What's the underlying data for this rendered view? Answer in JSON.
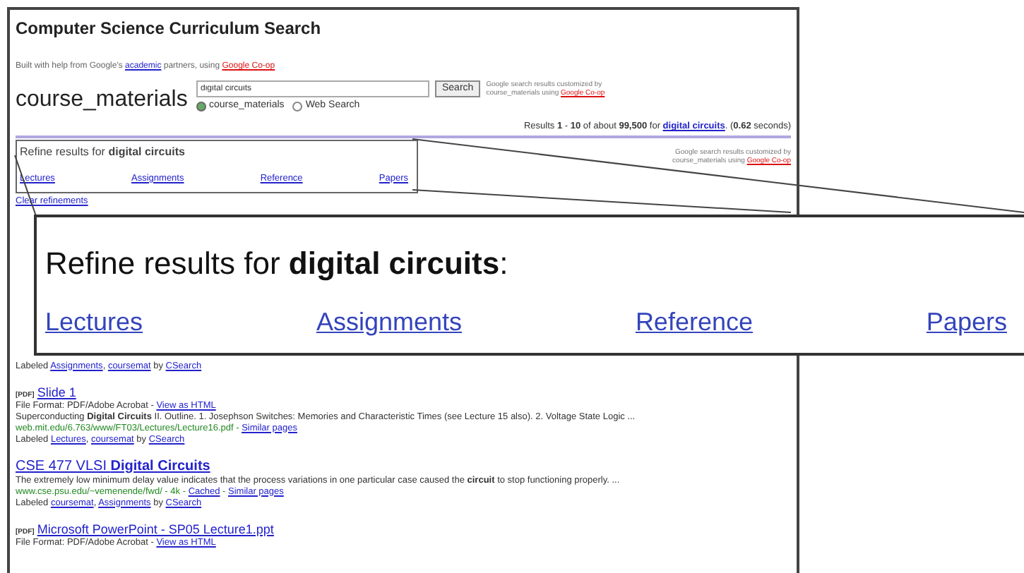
{
  "header": {
    "title": "Computer Science Curriculum Search",
    "credit": [
      {
        "kind": "plain",
        "text": "Built with help from Google's "
      },
      {
        "kind": "link",
        "text": "academic"
      },
      {
        "kind": "plain",
        "text": " partners, using "
      },
      {
        "kind": "red",
        "text": "Google Co-op"
      }
    ]
  },
  "search": {
    "engine_name": "course_materials",
    "query": "digital circuits",
    "button": "Search",
    "options": [
      {
        "label": "course_materials",
        "selected": true
      },
      {
        "label": "Web Search",
        "selected": false
      }
    ],
    "note": [
      {
        "kind": "plain",
        "text": "Google search results customized by course_materials using "
      },
      {
        "kind": "red",
        "text": "Google Co-op"
      }
    ]
  },
  "results_summary": [
    {
      "kind": "plain",
      "text": "Results "
    },
    {
      "kind": "bold",
      "text": "1"
    },
    {
      "kind": "plain",
      "text": " - "
    },
    {
      "kind": "bold",
      "text": "10"
    },
    {
      "kind": "plain",
      "text": " of about "
    },
    {
      "kind": "bold",
      "text": "99,500"
    },
    {
      "kind": "plain",
      "text": " for "
    },
    {
      "kind": "boldlink",
      "text": "digital circuits"
    },
    {
      "kind": "plain",
      "text": ". ("
    },
    {
      "kind": "bold",
      "text": "0.62"
    },
    {
      "kind": "plain",
      "text": " seconds)"
    }
  ],
  "refine": {
    "heading": "Refine results for **digital circuits**",
    "links": [
      "Lectures",
      "Assignments",
      "Reference",
      "Papers"
    ],
    "clear": "Clear refinements"
  },
  "side_note": [
    {
      "kind": "plain",
      "text": "Google search results customized by course_materials using "
    },
    {
      "kind": "red",
      "text": "Google Co-op"
    }
  ],
  "callout": {
    "heading": "Refine results for **digital circuits**:",
    "links": [
      "Lectures",
      "Assignments",
      "Reference",
      "Papers"
    ]
  },
  "results": [
    {
      "labels": [
        {
          "kind": "plain",
          "text": "Labeled "
        },
        {
          "kind": "link",
          "text": "Assignments"
        },
        {
          "kind": "plain",
          "text": ", "
        },
        {
          "kind": "link",
          "text": "coursemat"
        },
        {
          "kind": "plain",
          "text": " by "
        },
        {
          "kind": "link",
          "text": "CSearch"
        }
      ]
    },
    {
      "file_type": "[PDF]",
      "title": "Slide 1",
      "format": [
        {
          "kind": "plain",
          "text": "File Format: PDF/Adobe Acrobat - "
        },
        {
          "kind": "link",
          "text": "View as HTML"
        }
      ],
      "snippet": "Superconducting **Digital Circuits** II. Outline. 1. Josephson Switches: Memories and Characteristic Times (see Lecture 15 also). 2. Voltage State Logic ...",
      "url": [
        {
          "kind": "url",
          "text": "web.mit.edu/6.763/www/FT03/Lectures/Lecture16.pdf - "
        },
        {
          "kind": "link",
          "text": "Similar pages"
        }
      ],
      "labels": [
        {
          "kind": "plain",
          "text": "Labeled "
        },
        {
          "kind": "link",
          "text": "Lectures"
        },
        {
          "kind": "plain",
          "text": ", "
        },
        {
          "kind": "link",
          "text": "coursemat"
        },
        {
          "kind": "plain",
          "text": " by "
        },
        {
          "kind": "link",
          "text": "CSearch"
        }
      ]
    },
    {
      "title": "CSE 477 VLSI **Digital Circuits**",
      "snippet": "The extremely low minimum delay value indicates that the process variations in one particular case caused the **circuit** to stop functioning properly. ...",
      "url": [
        {
          "kind": "url",
          "text": "www.cse.psu.edu/~vemenende/fwd/ - 4k - "
        },
        {
          "kind": "link",
          "text": "Cached"
        },
        {
          "kind": "url",
          "text": " - "
        },
        {
          "kind": "link",
          "text": "Similar pages"
        }
      ],
      "labels": [
        {
          "kind": "plain",
          "text": "Labeled "
        },
        {
          "kind": "link",
          "text": "coursemat"
        },
        {
          "kind": "plain",
          "text": ", "
        },
        {
          "kind": "link",
          "text": "Assignments"
        },
        {
          "kind": "plain",
          "text": " by "
        },
        {
          "kind": "link",
          "text": "CSearch"
        }
      ]
    },
    {
      "file_type": "[PDF]",
      "title": "Microsoft PowerPoint - SP05 Lecture1.ppt",
      "format": [
        {
          "kind": "plain",
          "text": "File Format: PDF/Adobe Acrobat - "
        },
        {
          "kind": "link",
          "text": "View as HTML"
        }
      ]
    }
  ]
}
